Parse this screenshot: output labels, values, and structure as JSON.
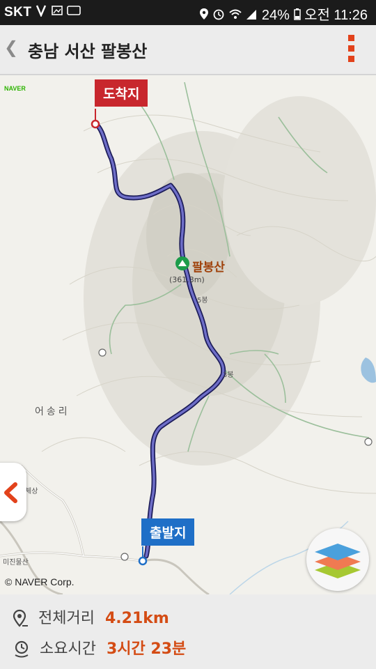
{
  "status_bar": {
    "carrier": "SKT",
    "battery": "24%",
    "time": "오전 11:26"
  },
  "header": {
    "title": "충남 서산 팔봉산"
  },
  "map": {
    "provider_logo": "NAVER",
    "copyright": "© NAVER Corp.",
    "end_label": "도착지",
    "start_label": "출발지",
    "peak_name": "팔봉산",
    "peak_elevation": "(361.3m)",
    "village_label": "어송리",
    "small_labels": [
      "5봉",
      "3봉",
      "체상",
      "미진물산"
    ],
    "route_color": "#3a3a9c"
  },
  "info": {
    "distance_label": "전체거리",
    "distance_value": "4.21km",
    "time_label": "소요시간",
    "time_value": "3시간 23분"
  },
  "colors": {
    "accent": "#d44c14",
    "end_flag": "#c8272d",
    "start_flag": "#1f6fc7"
  }
}
